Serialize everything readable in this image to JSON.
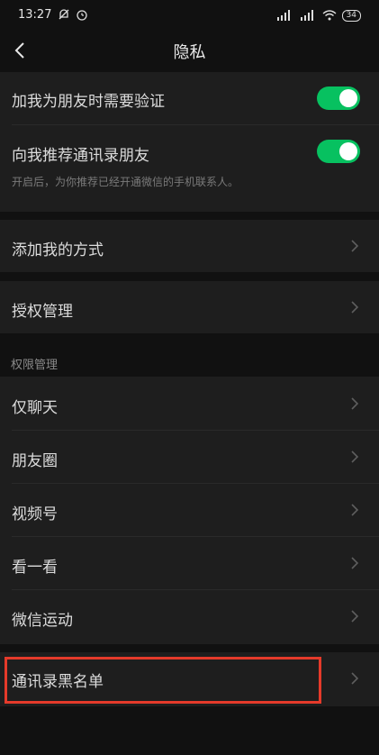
{
  "status_bar": {
    "time": "13:27",
    "battery": "34"
  },
  "nav": {
    "title": "隐私"
  },
  "verification": {
    "items": [
      {
        "label": "加我为朋友时需要验证",
        "toggle": "on"
      },
      {
        "label": "向我推荐通讯录朋友",
        "toggle": "on"
      }
    ],
    "hint": "开启后，为你推荐已经开通微信的手机联系人。"
  },
  "add_method": {
    "label": "添加我的方式"
  },
  "auth_manage": {
    "label": "授权管理"
  },
  "permission": {
    "group_label": "权限管理",
    "items": [
      {
        "label": "仅聊天"
      },
      {
        "label": "朋友圈"
      },
      {
        "label": "视频号"
      },
      {
        "label": "看一看"
      },
      {
        "label": "微信运动"
      }
    ]
  },
  "blacklist": {
    "label": "通讯录黑名单"
  },
  "colors": {
    "background": "#111111",
    "cell": "#1e1e1e",
    "toggle_on": "#07c160",
    "highlight": "#e53a2a"
  }
}
